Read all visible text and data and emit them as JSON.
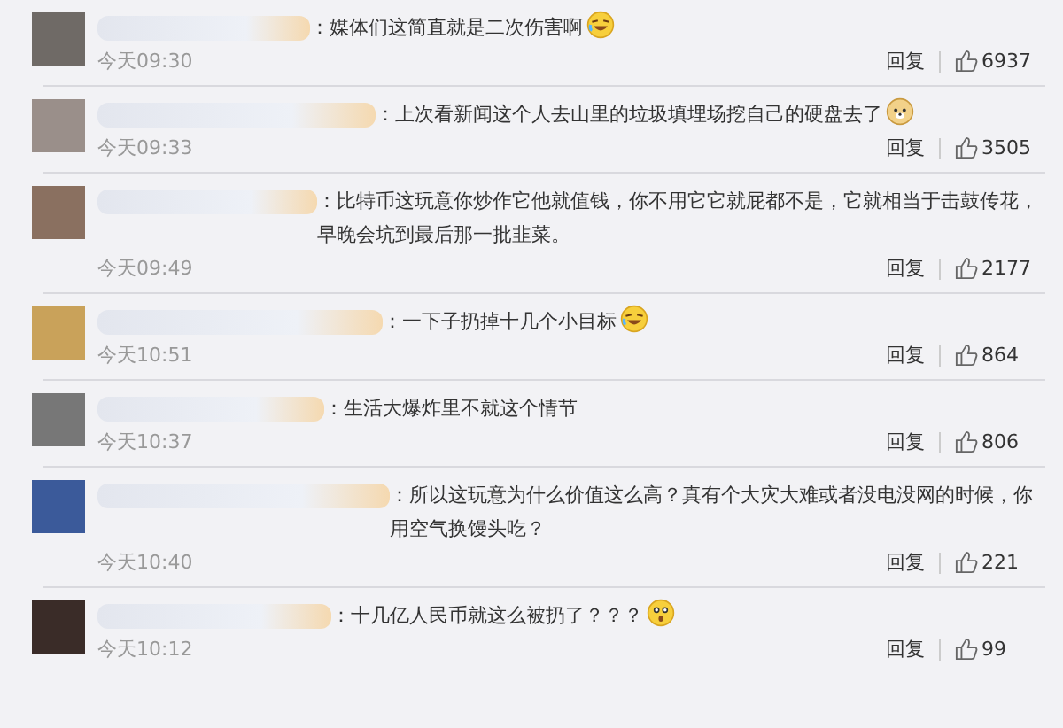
{
  "comments": [
    {
      "text": "：媒体们这简直就是二次伤害啊",
      "emoji": {
        "kind": "laugh-cry"
      },
      "time": "今天09:30",
      "reply": "回复",
      "likes": "6937"
    },
    {
      "text": "：上次看新闻这个人去山里的垃圾填埋场挖自己的硬盘去了",
      "emoji": {
        "kind": "dog"
      },
      "time": "今天09:33",
      "reply": "回复",
      "likes": "3505"
    },
    {
      "text": "：比特币这玩意你炒作它他就值钱，你不用它它就屁都不是，它就相当于击鼓传花，早晚会坑到最后那一批韭菜。",
      "time": "今天09:49",
      "reply": "回复",
      "likes": "2177"
    },
    {
      "text": "：一下子扔掉十几个小目标",
      "emoji": {
        "kind": "laugh-cry"
      },
      "time": "今天10:51",
      "reply": "回复",
      "likes": "864"
    },
    {
      "text": "：生活大爆炸里不就这个情节",
      "time": "今天10:37",
      "reply": "回复",
      "likes": "806"
    },
    {
      "text": "：所以这玩意为什么价值这么高？真有个大灾大难或者没电没网的时候，你用空气换馒头吃？",
      "time": "今天10:40",
      "reply": "回复",
      "likes": "221"
    },
    {
      "text": "：十几亿人民币就这么被扔了？？？",
      "emoji": {
        "kind": "surprised"
      },
      "time": "今天10:12",
      "reply": "回复",
      "likes": "99"
    }
  ]
}
